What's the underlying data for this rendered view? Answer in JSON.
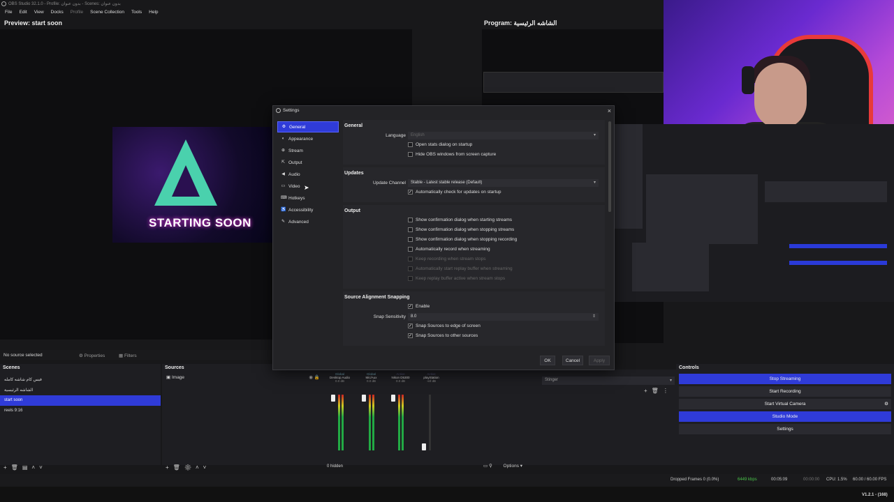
{
  "window": {
    "title": "OBS Studio 32.1.0 - Profile: بدون عنوان - Scenes: بدون عنوان"
  },
  "menu": [
    "File",
    "Edit",
    "View",
    "Docks",
    "Profile",
    "Scene Collection",
    "Tools",
    "Help"
  ],
  "preview": {
    "label": "Preview: start soon",
    "image_text": "STARTING SOON"
  },
  "program": {
    "label": "Program: الشاشه الرئيسية"
  },
  "below_preview": {
    "no_source": "No source selected",
    "properties": "Properties",
    "filters": "Filters"
  },
  "scenes": {
    "title": "Scenes",
    "items": [
      "فيس كام شاشه كامله",
      "الشاشه الرئيسية",
      "start soon",
      "reels 9:16"
    ],
    "selected_index": 2
  },
  "sources": {
    "title": "Sources",
    "items": [
      "Image"
    ]
  },
  "mixer": {
    "channels": [
      {
        "tag": "Global",
        "name": "Desktop Audio",
        "db": "0.0 dB"
      },
      {
        "tag": "Global",
        "name": "Mic/Aux",
        "db": "0.0 dB"
      },
      {
        "tag": "Active",
        "name": "Nikon D5300",
        "db": "0.0 dB"
      },
      {
        "tag": "Active",
        "name": "playStation",
        "db": "-inf dB"
      }
    ],
    "scale": [
      "0",
      "-6",
      "-12",
      "-18",
      "-24",
      "-30",
      "-36",
      "-42",
      "-48",
      "-54",
      "-60"
    ],
    "hidden": "0 hidden",
    "options": "Options"
  },
  "transitions": {
    "selected": "Stinger"
  },
  "controls": {
    "title": "Controls",
    "buttons": [
      "Stop Streaming",
      "Start Recording",
      "Start Virtual Camera",
      "Studio Mode",
      "Settings"
    ]
  },
  "status": {
    "dropped": "Dropped Frames 0 (0.0%)",
    "bitrate": "6449 kbps",
    "stream_time": "00:05:09",
    "rec_time": "00:00:00",
    "cpu": "CPU: 1.5%",
    "fps": "60.00 / 60.00 FPS",
    "version": "V1.2.1 - (168)"
  },
  "dialog": {
    "title": "Settings",
    "nav": [
      "General",
      "Appearance",
      "Stream",
      "Output",
      "Audio",
      "Video",
      "Hotkeys",
      "Accessibility",
      "Advanced"
    ],
    "nav_selected": 0,
    "general": {
      "title": "General",
      "language_label": "Language",
      "language_value": "English",
      "checks": [
        {
          "label": "Open stats dialog on startup",
          "checked": false
        },
        {
          "label": "Hide OBS windows from screen capture",
          "checked": false
        }
      ]
    },
    "updates": {
      "title": "Updates",
      "channel_label": "Update Channel",
      "channel_value": "Stable - Latest stable release (Default)",
      "check_label": "Automatically check for updates on startup",
      "checked": true
    },
    "output": {
      "title": "Output",
      "checks": [
        {
          "label": "Show confirmation dialog when starting streams",
          "checked": false,
          "disabled": false
        },
        {
          "label": "Show confirmation dialog when stopping streams",
          "checked": false,
          "disabled": false
        },
        {
          "label": "Show confirmation dialog when stopping recording",
          "checked": false,
          "disabled": false
        },
        {
          "label": "Automatically record when streaming",
          "checked": false,
          "disabled": false
        },
        {
          "label": "Keep recording when stream stops",
          "checked": false,
          "disabled": true
        },
        {
          "label": "Automatically start replay buffer when streaming",
          "checked": false,
          "disabled": true
        },
        {
          "label": "Keep replay buffer active when stream stops",
          "checked": false,
          "disabled": true
        }
      ]
    },
    "snapping": {
      "title": "Source Alignment Snapping",
      "enable_label": "Enable",
      "sensitivity_label": "Snap Sensitivity",
      "sensitivity_value": "8.0",
      "checks": [
        {
          "label": "Snap Sources to edge of screen",
          "checked": true
        },
        {
          "label": "Snap Sources to other sources",
          "checked": true
        }
      ]
    },
    "buttons": {
      "ok": "OK",
      "cancel": "Cancel",
      "apply": "Apply"
    }
  }
}
